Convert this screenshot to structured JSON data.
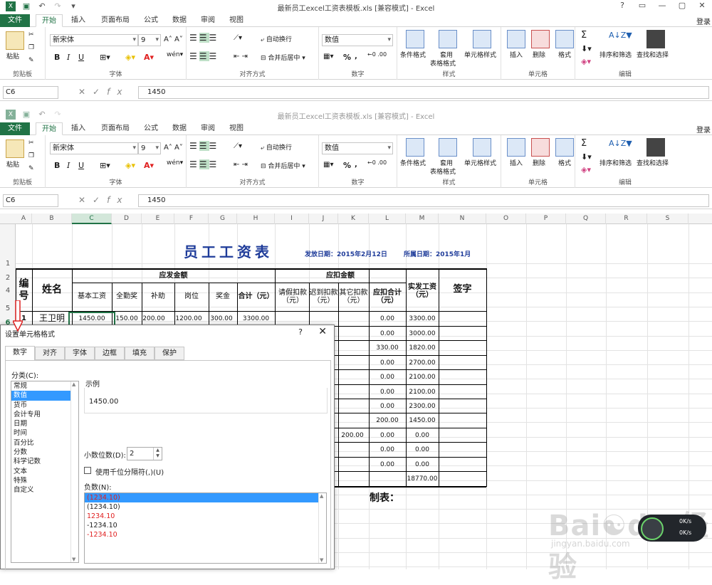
{
  "window": {
    "title": "最新员工excel工资表模板.xls  [兼容模式] - Excel",
    "controls": [
      "?",
      "▭",
      "—",
      "▢",
      "✕"
    ],
    "login": "登录"
  },
  "tabs": [
    "文件",
    "开始",
    "插入",
    "页面布局",
    "公式",
    "数据",
    "审阅",
    "视图"
  ],
  "ribbon": {
    "clipboard": {
      "label": "剪贴板",
      "paste": "粘贴"
    },
    "font": {
      "label": "字体",
      "name": "新宋体",
      "size": "9",
      "bold": "B",
      "italic": "I",
      "underline": "U"
    },
    "alignment": {
      "label": "对齐方式",
      "wrap": "自动换行",
      "merge": "合并后居中"
    },
    "number": {
      "label": "数字",
      "format": "数值",
      "percent": "%"
    },
    "styles": {
      "label": "样式",
      "cond": "条件格式",
      "table1": "套用",
      "table2": "表格格式",
      "cell": "单元格样式"
    },
    "cells": {
      "label": "单元格",
      "insert": "插入",
      "delete": "删除",
      "format": "格式"
    },
    "editing": {
      "label": "编辑",
      "sigma": "Σ",
      "sort": "排序和筛选",
      "find": "查找和选择"
    }
  },
  "formula_bar": {
    "cell": "C6",
    "fx": "fx",
    "value": "1450"
  },
  "columns": [
    "A",
    "B",
    "C",
    "D",
    "E",
    "F",
    "G",
    "H",
    "I",
    "J",
    "K",
    "L",
    "M",
    "N",
    "O",
    "P",
    "Q",
    "R",
    "S"
  ],
  "rows": [
    "1",
    "2",
    "4",
    "5",
    "6"
  ],
  "sheet": {
    "title": "员工工资表",
    "issue_date": "发放日期：2015年2月12日",
    "belong_date": "所属日期：2015年1月",
    "h_no": "编号",
    "h_name": "姓名",
    "h_payable": "应发金额",
    "h_deduct": "应扣金额",
    "h_actual": "实发工资（元）",
    "h_sign": "签字",
    "sub_payable": [
      "基本工资",
      "全勤奖",
      "补助",
      "岗位",
      "奖金",
      "合计（元）"
    ],
    "sub_deduct": [
      "请假扣款（元）",
      "迟到扣款（元）",
      "其它扣款（元）",
      "应扣合计（元）"
    ],
    "row1": {
      "no": "1",
      "name": "王卫明",
      "basic": "1450.00",
      "attend": "150.00",
      "allow": "200.00",
      "post": "1200.00",
      "bonus": "300.00",
      "total": "3300.00",
      "ded_total": "0.00",
      "actual": "3300.00"
    },
    "ded_other": [
      "",
      "",
      "",
      "",
      "",
      "",
      "",
      "200.00",
      "",
      "",
      ""
    ],
    "ded_totals": [
      "0.00",
      "330.00",
      "0.00",
      "0.00",
      "0.00",
      "0.00",
      "200.00",
      "0.00",
      "0.00",
      "0.00"
    ],
    "actuals": [
      "3000.00",
      "1820.00",
      "2700.00",
      "2100.00",
      "2100.00",
      "2300.00",
      "1450.00",
      "0.00",
      "0.00",
      "0.00",
      "18770.00"
    ],
    "maker": "制表："
  },
  "dialog": {
    "title": "设置单元格格式",
    "help": "?",
    "close": "✕",
    "tabs": [
      "数字",
      "对齐",
      "字体",
      "边框",
      "填充",
      "保护"
    ],
    "category_label": "分类(C):",
    "categories": [
      "常规",
      "数值",
      "货币",
      "会计专用",
      "日期",
      "时间",
      "百分比",
      "分数",
      "科学记数",
      "文本",
      "特殊",
      "自定义"
    ],
    "selected_category": "数值",
    "sample_label": "示例",
    "sample_value": "1450.00",
    "decimals_label": "小数位数(D):",
    "decimals": "2",
    "thousands_label": "使用千位分隔符(,)(U)",
    "negative_label": "负数(N):",
    "negatives": [
      "(1234.10)",
      "(1234.10)",
      "1234.10",
      "-1234.10",
      "-1234.10"
    ],
    "negative_colors": [
      "#e02020",
      "#222222",
      "#e02020",
      "#222222",
      "#e02020"
    ]
  },
  "watermark": {
    "text": "Bai du 经验",
    "url": "jingyan.baidu.com"
  },
  "net_monitor": {
    "up": "0K/s",
    "down": "0K/s"
  }
}
